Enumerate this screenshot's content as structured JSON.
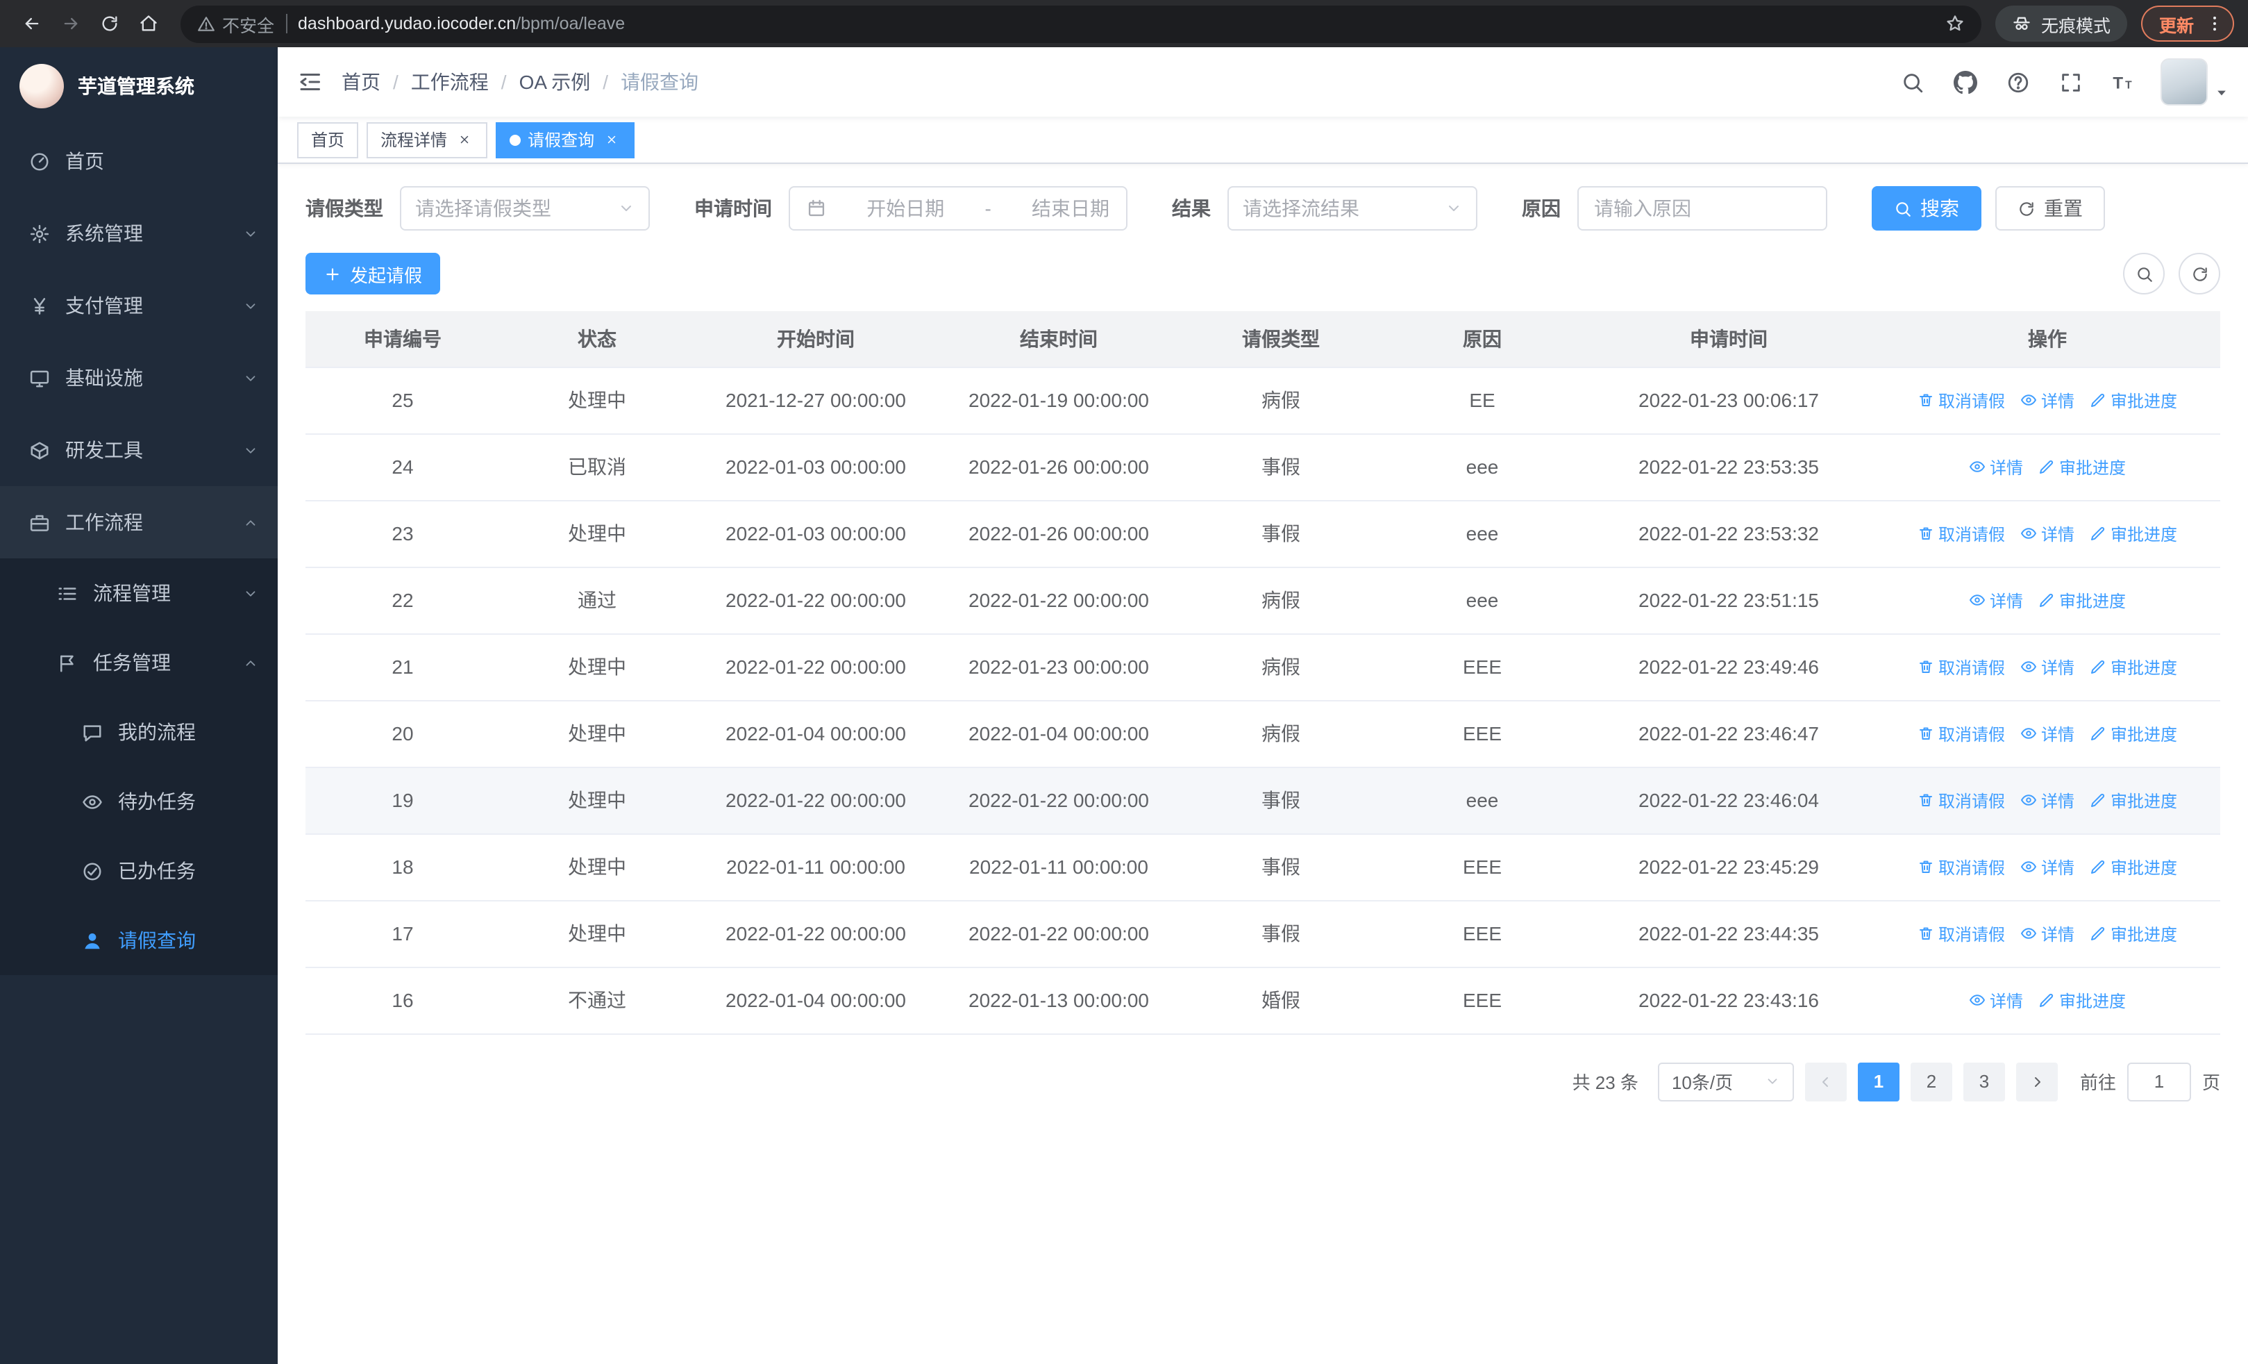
{
  "colors": {
    "primary": "#409eff",
    "sidebar_bg": "#202b3a",
    "sidebar_submenu_bg": "#1a2330",
    "active_tab_bg": "#409eff",
    "link": "#409eff",
    "table_header_bg": "#f2f3f5",
    "update_accent": "#ff8a65"
  },
  "browser": {
    "security_warning": "不安全",
    "url_domain": "dashboard.yudao.iocoder.cn",
    "url_path": "/bpm/oa/leave",
    "incognito_label": "无痕模式",
    "update_label": "更新"
  },
  "sidebar": {
    "logo_title": "芋道管理系统",
    "items": [
      {
        "label": "首页",
        "icon": "gauge"
      },
      {
        "label": "系统管理",
        "icon": "gear"
      },
      {
        "label": "支付管理",
        "icon": "yen"
      },
      {
        "label": "基础设施",
        "icon": "monitor"
      },
      {
        "label": "研发工具",
        "icon": "cube"
      },
      {
        "label": "工作流程",
        "icon": "briefcase",
        "expanded": true,
        "children": [
          {
            "label": "流程管理",
            "icon": "list"
          },
          {
            "label": "任务管理",
            "icon": "flag",
            "expanded": true,
            "children": [
              {
                "label": "我的流程",
                "icon": "chat"
              },
              {
                "label": "待办任务",
                "icon": "eye"
              },
              {
                "label": "已办任务",
                "icon": "check-circle"
              },
              {
                "label": "请假查询",
                "icon": "user",
                "active": true
              }
            ]
          }
        ]
      }
    ]
  },
  "breadcrumb": {
    "separator": "/",
    "items": [
      "首页",
      "工作流程",
      "OA 示例",
      "请假查询"
    ]
  },
  "tabs": [
    {
      "label": "首页",
      "closable": false,
      "active": false
    },
    {
      "label": "流程详情",
      "closable": true,
      "active": false
    },
    {
      "label": "请假查询",
      "closable": true,
      "active": true
    }
  ],
  "filters": {
    "leave_type": {
      "label": "请假类型",
      "placeholder": "请选择请假类型"
    },
    "apply_time": {
      "label": "申请时间",
      "start_placeholder": "开始日期",
      "separator": "-",
      "end_placeholder": "结束日期"
    },
    "result": {
      "label": "结果",
      "placeholder": "请选择流结果"
    },
    "reason": {
      "label": "原因",
      "placeholder": "请输入原因"
    },
    "search_label": "搜索",
    "reset_label": "重置"
  },
  "toolbar": {
    "create_label": "发起请假"
  },
  "table": {
    "columns": [
      "申请编号",
      "状态",
      "开始时间",
      "结束时间",
      "请假类型",
      "原因",
      "申请时间",
      "操作"
    ],
    "action_labels": {
      "cancel": "取消请假",
      "detail": "详情",
      "progress": "审批进度"
    },
    "rows": [
      {
        "id": "25",
        "status": "处理中",
        "start": "2021-12-27 00:00:00",
        "end": "2022-01-19 00:00:00",
        "type": "病假",
        "reason": "EE",
        "apply_time": "2022-01-23 00:06:17",
        "can_cancel": true
      },
      {
        "id": "24",
        "status": "已取消",
        "start": "2022-01-03 00:00:00",
        "end": "2022-01-26 00:00:00",
        "type": "事假",
        "reason": "eee",
        "apply_time": "2022-01-22 23:53:35",
        "can_cancel": false
      },
      {
        "id": "23",
        "status": "处理中",
        "start": "2022-01-03 00:00:00",
        "end": "2022-01-26 00:00:00",
        "type": "事假",
        "reason": "eee",
        "apply_time": "2022-01-22 23:53:32",
        "can_cancel": true
      },
      {
        "id": "22",
        "status": "通过",
        "start": "2022-01-22 00:00:00",
        "end": "2022-01-22 00:00:00",
        "type": "病假",
        "reason": "eee",
        "apply_time": "2022-01-22 23:51:15",
        "can_cancel": false
      },
      {
        "id": "21",
        "status": "处理中",
        "start": "2022-01-22 00:00:00",
        "end": "2022-01-23 00:00:00",
        "type": "病假",
        "reason": "EEE",
        "apply_time": "2022-01-22 23:49:46",
        "can_cancel": true
      },
      {
        "id": "20",
        "status": "处理中",
        "start": "2022-01-04 00:00:00",
        "end": "2022-01-04 00:00:00",
        "type": "病假",
        "reason": "EEE",
        "apply_time": "2022-01-22 23:46:47",
        "can_cancel": true
      },
      {
        "id": "19",
        "status": "处理中",
        "start": "2022-01-22 00:00:00",
        "end": "2022-01-22 00:00:00",
        "type": "事假",
        "reason": "eee",
        "apply_time": "2022-01-22 23:46:04",
        "can_cancel": true,
        "highlighted": true
      },
      {
        "id": "18",
        "status": "处理中",
        "start": "2022-01-11 00:00:00",
        "end": "2022-01-11 00:00:00",
        "type": "事假",
        "reason": "EEE",
        "apply_time": "2022-01-22 23:45:29",
        "can_cancel": true
      },
      {
        "id": "17",
        "status": "处理中",
        "start": "2022-01-22 00:00:00",
        "end": "2022-01-22 00:00:00",
        "type": "事假",
        "reason": "EEE",
        "apply_time": "2022-01-22 23:44:35",
        "can_cancel": true
      },
      {
        "id": "16",
        "status": "不通过",
        "start": "2022-01-04 00:00:00",
        "end": "2022-01-13 00:00:00",
        "type": "婚假",
        "reason": "EEE",
        "apply_time": "2022-01-22 23:43:16",
        "can_cancel": false
      }
    ]
  },
  "pagination": {
    "total_text": "共 23 条",
    "page_size": "10条/页",
    "pages": [
      "1",
      "2",
      "3"
    ],
    "active_page": "1",
    "goto_label": "前往",
    "goto_value": "1",
    "goto_unit": "页"
  }
}
